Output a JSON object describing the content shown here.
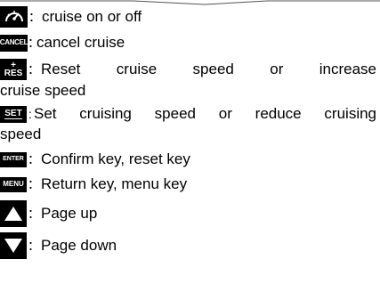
{
  "colors": {
    "icon_bg": "#000000",
    "icon_fg": "#ffffff",
    "text": "#000000"
  },
  "items": [
    {
      "icon": "cruise-gauge-icon",
      "sep": "：",
      "text": "cruise on or off"
    },
    {
      "icon_text": "CANCEL",
      "sep": "：",
      "text": "cancel cruise"
    },
    {
      "icon_text": "RES",
      "icon_plus": "+",
      "sep": "：",
      "text_line1": "Reset cruise speed or increase",
      "text_line2": "cruise speed"
    },
    {
      "icon_text": "SET",
      "sep": ":",
      "text_line1": "Set cruising speed or reduce cruising",
      "text_line2": "speed"
    },
    {
      "icon_text": "ENTER",
      "sep": "：",
      "text": "Confirm key, reset key"
    },
    {
      "icon_text": "MENU",
      "sep": "：",
      "text": "Return key, menu key"
    },
    {
      "icon": "triangle-up-icon",
      "sep": "：",
      "text": "Page up"
    },
    {
      "icon": "triangle-down-icon",
      "sep": "：",
      "text": "Page down"
    }
  ]
}
